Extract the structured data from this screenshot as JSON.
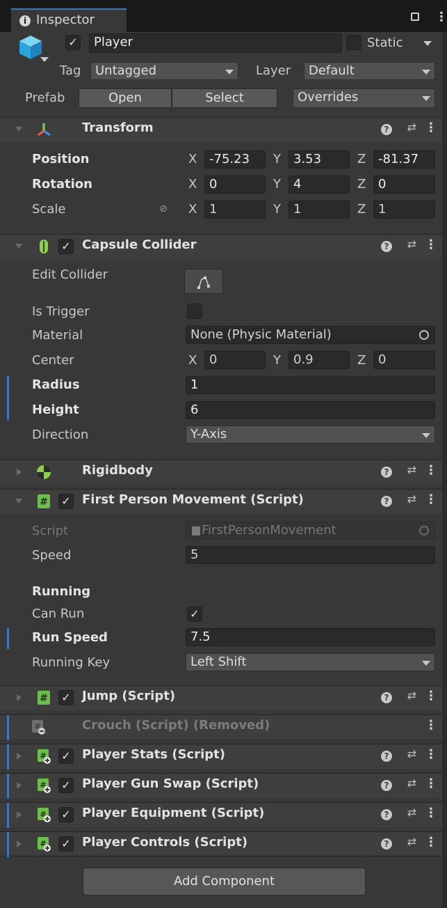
{
  "window": {
    "tab_title": "Inspector",
    "info_icon": "info-circle-icon",
    "lock_icon": "lock-icon",
    "menu_icon": "vertical-ellipsis-icon"
  },
  "object": {
    "name": "Player",
    "active": true,
    "static_label": "Static",
    "tag_label": "Tag",
    "tag_value": "Untagged",
    "layer_label": "Layer",
    "layer_value": "Default",
    "prefab_label": "Prefab",
    "open_label": "Open",
    "select_label": "Select",
    "overrides_label": "Overrides"
  },
  "transform": {
    "title": "Transform",
    "rows": [
      {
        "label": "Position",
        "x": "-75.23",
        "y": "3.53",
        "z": "-81.37"
      },
      {
        "label": "Rotation",
        "x": "0",
        "y": "4",
        "z": "0"
      },
      {
        "label": "Scale",
        "x": "1",
        "y": "1",
        "z": "1"
      }
    ],
    "axis_x": "X",
    "axis_y": "Y",
    "axis_z": "Z"
  },
  "capsule": {
    "title": "Capsule Collider",
    "edit_collider": "Edit Collider",
    "is_trigger": "Is Trigger",
    "material_label": "Material",
    "material_value": "None (Physic Material)",
    "center_label": "Center",
    "center_x": "0",
    "center_y": "0.9",
    "center_z": "0",
    "radius_label": "Radius",
    "radius_value": "1",
    "height_label": "Height",
    "height_value": "6",
    "direction_label": "Direction",
    "direction_value": "Y-Axis"
  },
  "rigidbody": {
    "title": "Rigidbody"
  },
  "fpm": {
    "title": "First Person Movement (Script)",
    "script_label": "Script",
    "script_value": "FirstPersonMovement",
    "speed_label": "Speed",
    "speed_value": "5",
    "running_header": "Running",
    "can_run_label": "Can Run",
    "run_speed_label": "Run Speed",
    "run_speed_value": "7.5",
    "running_key_label": "Running Key",
    "running_key_value": "Left Shift"
  },
  "components": [
    {
      "title": "Jump (Script)"
    },
    {
      "title": "Crouch (Script) (Removed)"
    },
    {
      "title": "Player Stats (Script)"
    },
    {
      "title": "Player Gun Swap (Script)"
    },
    {
      "title": "Player Equipment (Script)"
    },
    {
      "title": "Player Controls (Script)"
    }
  ],
  "add_component": "Add Component",
  "colors": {
    "background": "#383838",
    "header": "#3e3e3e",
    "override_bar": "#3a79bb",
    "script_icon": "#6cc04a"
  }
}
